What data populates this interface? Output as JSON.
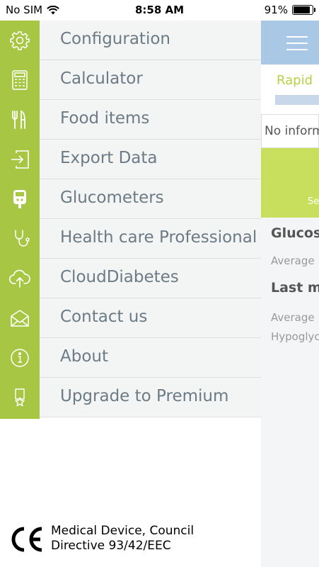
{
  "status_bar": {
    "carrier": "No SIM",
    "time": "8:58 AM",
    "battery": "91%",
    "battery_level": 0.91
  },
  "background_screen": {
    "tab_label": "Rapid",
    "info_text": "No inform",
    "green_label": "Se",
    "glucose_title": "Glucos",
    "average_label": "Average",
    "last_title": "Last m",
    "average_label_2": "Average",
    "hypo_label": "Hypoglyc"
  },
  "menu": {
    "items": [
      {
        "label": "Configuration",
        "icon": "gear-icon"
      },
      {
        "label": "Calculator",
        "icon": "calculator-icon"
      },
      {
        "label": "Food items",
        "icon": "fork-knife-icon"
      },
      {
        "label": "Export Data",
        "icon": "export-icon"
      },
      {
        "label": "Glucometers",
        "icon": "glucometer-icon"
      },
      {
        "label": "Health care Professional",
        "icon": "stethoscope-icon"
      },
      {
        "label": "CloudDiabetes",
        "icon": "cloud-upload-icon"
      },
      {
        "label": "Contact us",
        "icon": "envelope-icon"
      },
      {
        "label": "About",
        "icon": "info-icon"
      },
      {
        "label": "Upgrade to Premium",
        "icon": "premium-badge-icon"
      }
    ]
  },
  "footer": {
    "ce_line1": "Medical Device, Council",
    "ce_line2": "Directive 93/42/EEC"
  },
  "colors": {
    "rail": "#a7c744",
    "header_blue": "#a9c8e6",
    "accent_green": "#c8df5e",
    "menu_text": "#6c7b85"
  }
}
